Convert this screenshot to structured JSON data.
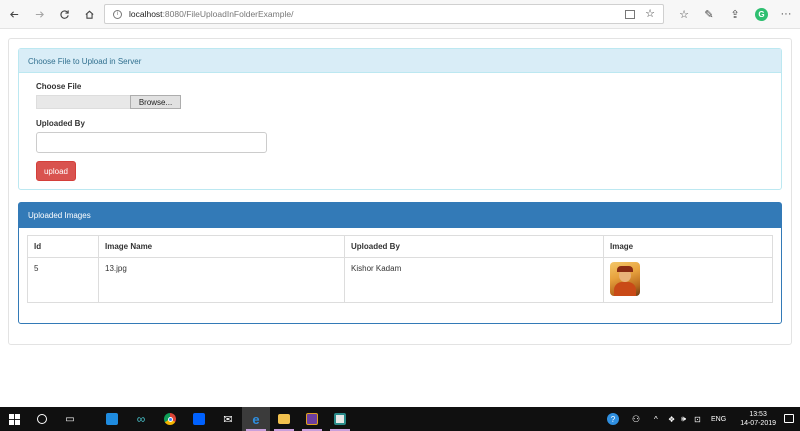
{
  "browser": {
    "url_host": "localhost",
    "url_rest": ":8080/FileUploadInFolderExample/"
  },
  "upload_panel": {
    "heading": "Choose File to Upload in Server",
    "choose_file_label": "Choose File",
    "browse_label": "Browse...",
    "uploaded_by_label": "Uploaded By",
    "uploaded_by_value": "",
    "upload_button": "upload"
  },
  "images_panel": {
    "heading": "Uploaded Images",
    "columns": [
      "Id",
      "Image Name",
      "Uploaded By",
      "Image"
    ],
    "rows": [
      {
        "id": "5",
        "image_name": "13.jpg",
        "uploaded_by": "Kishor Kadam"
      }
    ]
  },
  "taskbar": {
    "language": "ENG",
    "time": "13:53",
    "date": "14-07-2019"
  },
  "colors": {
    "info_header_bg": "#d9edf7",
    "primary": "#337ab7",
    "danger": "#d9534f"
  }
}
